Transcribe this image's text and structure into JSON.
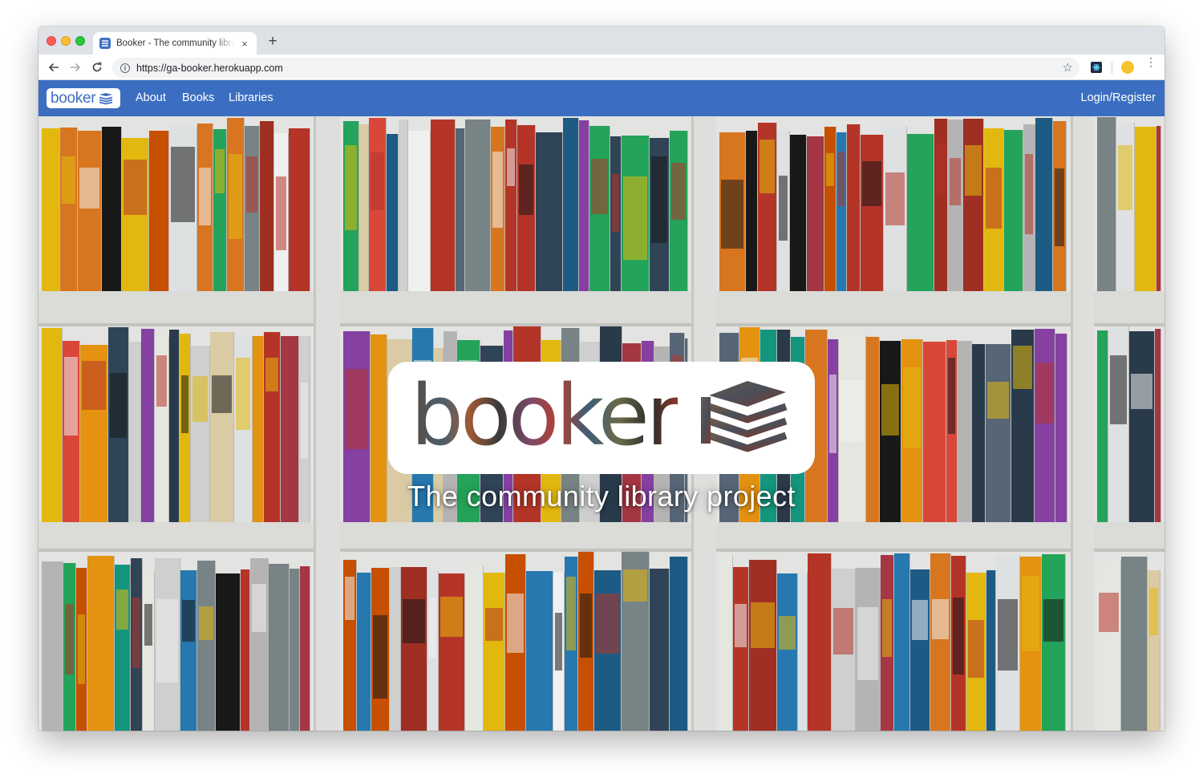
{
  "browser": {
    "tab_title": "Booker - The community library project",
    "tab_close": "×",
    "new_tab": "+",
    "url": "https://ga-booker.herokuapp.com",
    "star": "☆",
    "menu": "⋮"
  },
  "navbar": {
    "brand": "booker",
    "links": [
      "About",
      "Books",
      "Libraries"
    ],
    "login": "Login/Register",
    "color": "#3b6ec1"
  },
  "hero": {
    "logo_word": "booker",
    "tagline": "The community library project"
  },
  "icons": [
    "booker-favicon",
    "back-arrow-icon",
    "forward-arrow-icon",
    "reload-icon",
    "info-icon",
    "bookmark-star-icon",
    "extension-icon",
    "extension-avatar-icon",
    "menu-dots-icon",
    "book-stack-icon"
  ]
}
